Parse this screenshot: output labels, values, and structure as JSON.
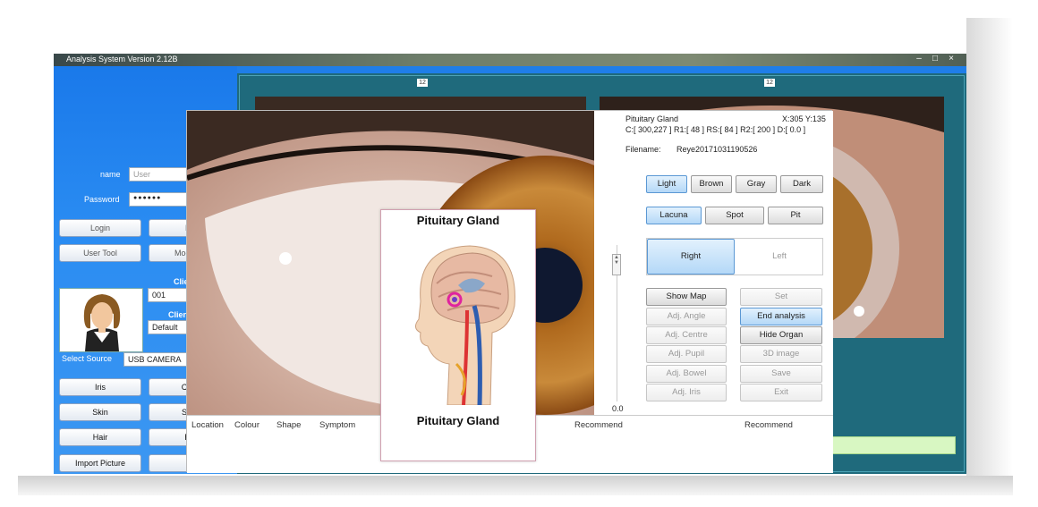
{
  "window": {
    "title": "Analysis System Version 2.12B",
    "controls": [
      "–",
      "□",
      "×"
    ]
  },
  "login": {
    "name_label": "name",
    "name_placeholder": "User",
    "password_label": "Password",
    "password_value": "●●●●●●",
    "login_button": "Login",
    "login2_button": "Lo",
    "user_tool_button": "User Tool",
    "modify_button": "Modify p"
  },
  "client": {
    "label1": "Clie",
    "value1": "001",
    "label2": "Clien",
    "value2": "Default"
  },
  "source": {
    "label": "Select Source",
    "value": "USB CAMERA"
  },
  "left_buttons": {
    "iris": "Iris",
    "clear": "Clea",
    "skin": "Skin",
    "select": "Sele",
    "hair": "Hair",
    "re": "Re",
    "import_picture": "Import Picture",
    "e": "E"
  },
  "analysis": {
    "organ": "Pituitary Gland",
    "coords": "X:305 Y:135",
    "params": "C:[ 300,227 ] R1:[ 48 ] RS:[ 84 ] R2:[ 200 ] D:[ 0.0 ]",
    "filename_label": "Filename:",
    "filename_value": "Reye20171031190526",
    "colors": [
      "Light",
      "Brown",
      "Gray",
      "Dark"
    ],
    "colors_selected": "Light",
    "marks": [
      "Lacuna",
      "Spot",
      "Pit"
    ],
    "marks_selected": "Lacuna",
    "side_right": "Right",
    "side_left": "Left",
    "side_selected": "Right",
    "slider_value": "0.0",
    "slider_up": "▲",
    "slider_down": "▼",
    "show_map": "Show Map",
    "set": "Set",
    "adj_angle": "Adj. Angle",
    "end_analysis": "End analysis",
    "adj_centre": "Adj. Centre",
    "hide_organ": "Hide Organ",
    "adj_pupil": "Adj. Pupil",
    "image_3d": "3D image",
    "adj_bowel": "Adj. Bowel",
    "save": "Save",
    "adj_iris": "Adj. Iris",
    "exit": "Exit"
  },
  "table_headers": {
    "location": "Location",
    "colour": "Colour",
    "shape": "Shape",
    "symptom": "Symptom",
    "recommend1": "Recommend",
    "recommend2": "Recommend"
  },
  "popup": {
    "title": "Pituitary Gland",
    "caption": "Pituitary Gland"
  },
  "marker": "12",
  "colors": {
    "window_blue": "#1f7ee8",
    "teal_panel": "#1f6a7c",
    "selected_button": "#b4d8f7",
    "iris_brown": "#b06a1e"
  }
}
